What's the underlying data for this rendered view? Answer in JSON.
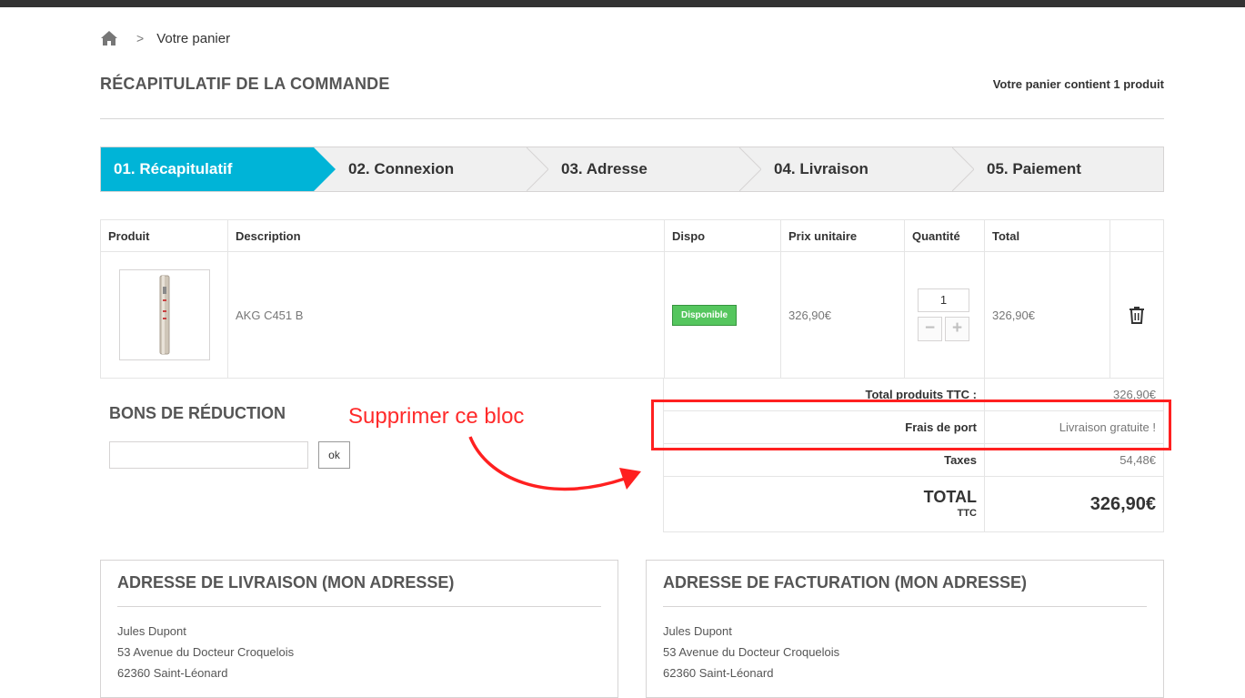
{
  "breadcrumb": {
    "home_icon": "home-icon",
    "separator": ">",
    "current": "Votre panier"
  },
  "header": {
    "title": "RÉCAPITULATIF DE LA COMMANDE",
    "cart_count": "Votre panier contient 1 produit"
  },
  "steps": [
    {
      "label": "01. Récapitulatif",
      "active": true
    },
    {
      "label": "02. Connexion",
      "active": false
    },
    {
      "label": "03. Adresse",
      "active": false
    },
    {
      "label": "04. Livraison",
      "active": false
    },
    {
      "label": "05. Paiement",
      "active": false
    }
  ],
  "colors": {
    "accent": "#00b4d7",
    "available": "#55c65e",
    "annotation": "#ff2020"
  },
  "table": {
    "headers": [
      "Produit",
      "Description",
      "Dispo",
      "Prix unitaire",
      "Quantité",
      "Total",
      ""
    ],
    "rows": [
      {
        "description": "AKG C451 B",
        "availability": "Disponible",
        "unit_price": "326,90€",
        "quantity": "1",
        "qty_minus": "−",
        "qty_plus": "+",
        "total": "326,90€",
        "delete_icon": "trash-icon"
      }
    ]
  },
  "totals": {
    "products_label": "Total produits TTC :",
    "products_value": "326,90€",
    "shipping_label": "Frais de port",
    "shipping_value": "Livraison gratuite !",
    "taxes_label": "Taxes",
    "taxes_value": "54,48€",
    "total_label": "TOTAL",
    "total_sub": "TTC",
    "total_value": "326,90€"
  },
  "vouchers": {
    "title": "BONS DE RÉDUCTION",
    "input_value": "",
    "button": "ok"
  },
  "annotation": {
    "text": "Supprimer ce bloc"
  },
  "addresses": {
    "delivery": {
      "title": "ADRESSE DE LIVRAISON (MON ADRESSE)",
      "name": "Jules Dupont",
      "street": "53 Avenue du Docteur Croquelois",
      "city": "62360 Saint-Léonard"
    },
    "billing": {
      "title": "ADRESSE DE FACTURATION (MON ADRESSE)",
      "name": "Jules Dupont",
      "street": "53 Avenue du Docteur Croquelois",
      "city": "62360 Saint-Léonard"
    }
  }
}
